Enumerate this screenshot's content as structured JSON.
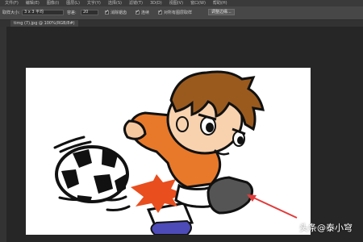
{
  "menu": [
    "文件(F)",
    "编辑(E)",
    "图像(I)",
    "图层(L)",
    "文字(Y)",
    "选择(S)",
    "滤镜(T)",
    "3D(D)",
    "视图(V)",
    "窗口(W)",
    "帮助(H)"
  ],
  "options": {
    "sample_size_label": "取样大小:",
    "sample_size_value": "3 x 3 平均",
    "tolerance_label": "容差:",
    "tolerance_value": "20",
    "antialias_label": "消除锯齿",
    "contiguous_label": "连续",
    "sample_all_layers_label": "对所有图层取样",
    "refine_edge_label": "调整边缘..."
  },
  "document_tab": "timg (7).jpg @ 100%(RGB/8#)",
  "watermark": "头条@泰小穹",
  "colors": {
    "workspace_bg": "#262626",
    "canvas_bg": "#ffffff",
    "shirt_orange": "#e8792a",
    "hair_brown": "#9a5a1e",
    "arrow_red": "#e23b3b"
  }
}
